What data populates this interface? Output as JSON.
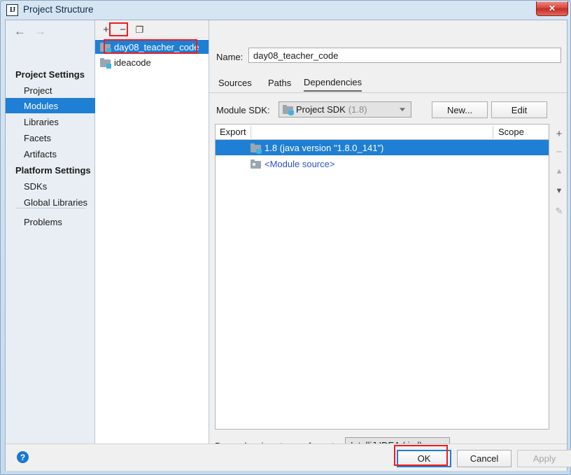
{
  "window": {
    "title": "Project Structure",
    "icon": "IJ",
    "close_label": "✕"
  },
  "sidebar": {
    "nav": {
      "back": "←",
      "forward": "→"
    },
    "groups": [
      {
        "label": "Project Settings",
        "items": [
          {
            "label": "Project",
            "selected": false
          },
          {
            "label": "Modules",
            "selected": true
          },
          {
            "label": "Libraries",
            "selected": false
          },
          {
            "label": "Facets",
            "selected": false
          },
          {
            "label": "Artifacts",
            "selected": false
          }
        ]
      },
      {
        "label": "Platform Settings",
        "items": [
          {
            "label": "SDKs",
            "selected": false
          },
          {
            "label": "Global Libraries",
            "selected": false
          }
        ]
      }
    ],
    "problems": {
      "label": "Problems"
    }
  },
  "modules_panel": {
    "toolbar": {
      "add": "+",
      "remove": "−",
      "copy": "❐"
    },
    "items": [
      {
        "label": "day08_teacher_code",
        "selected": true
      },
      {
        "label": "ideacode",
        "selected": false
      }
    ]
  },
  "detail": {
    "name_label": "Name:",
    "name_value": "day08_teacher_code",
    "tabs": [
      {
        "label": "Sources",
        "active": false
      },
      {
        "label": "Paths",
        "active": false
      },
      {
        "label": "Dependencies",
        "active": true
      }
    ],
    "sdk": {
      "label": "Module SDK:",
      "value": "Project SDK",
      "version": "(1.8)",
      "new_button": "New...",
      "edit_button": "Edit"
    },
    "table": {
      "columns": [
        "Export",
        "Scope"
      ],
      "rows": [
        {
          "label": "1.8 (java version \"1.8.0_141\")",
          "selected": true,
          "kind": "sdk"
        },
        {
          "label": "<Module source>",
          "selected": false,
          "kind": "module-source"
        }
      ],
      "side_toolbar": {
        "add": "+",
        "remove": "−",
        "move_up": "▲",
        "move_down": "▼",
        "edit": "✎"
      }
    },
    "storage": {
      "label": "Dependencies storage format:",
      "value": "IntelliJ IDEA (.iml)"
    }
  },
  "footer": {
    "help": "?",
    "ok": "OK",
    "cancel": "Cancel",
    "apply": "Apply"
  },
  "colors": {
    "selection_blue": "#1f7fd4",
    "annotation_red": "#ee1c20",
    "link_blue": "#2c52c9"
  }
}
